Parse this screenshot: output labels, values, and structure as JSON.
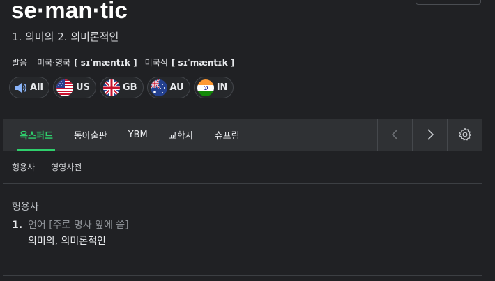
{
  "entry": {
    "word": "se·man·tic",
    "summary": "1. 의미의 2. 의미론적인"
  },
  "pronunciation": {
    "label": "발음",
    "variants": [
      {
        "region": "미국·영국",
        "ipa": "[ sɪˈmæntɪk ]"
      },
      {
        "region": "미국식",
        "ipa": "[ sɪˈmæntɪk ]"
      }
    ]
  },
  "audio_chips": [
    {
      "label": "All",
      "icon": "speaker-icon"
    },
    {
      "label": "US",
      "icon": "us-flag-icon"
    },
    {
      "label": "GB",
      "icon": "gb-flag-icon"
    },
    {
      "label": "AU",
      "icon": "au-flag-icon"
    },
    {
      "label": "IN",
      "icon": "in-flag-icon"
    }
  ],
  "dictionary_tabs": [
    {
      "label": "옥스퍼드",
      "active": true
    },
    {
      "label": "동아출판",
      "active": false
    },
    {
      "label": "YBM",
      "active": false
    },
    {
      "label": "교학사",
      "active": false
    },
    {
      "label": "슈프림",
      "active": false
    }
  ],
  "tab_controls": [
    "chevron-left-icon",
    "chevron-right-icon",
    "gear-icon"
  ],
  "sub_tabs": [
    "형용사",
    "영영사전"
  ],
  "definitions": {
    "part_of_speech": "형용사",
    "senses": [
      {
        "number": "1.",
        "note": "언어 [주로 명사 앞에 씀]",
        "definition": "의미의, 의미론적인"
      }
    ]
  },
  "colors": {
    "background": "#202124",
    "tab_bar": "#2f3134",
    "accent_green": "#2fcf6c",
    "text": "#e8eaed",
    "muted_text": "#8d9196"
  }
}
